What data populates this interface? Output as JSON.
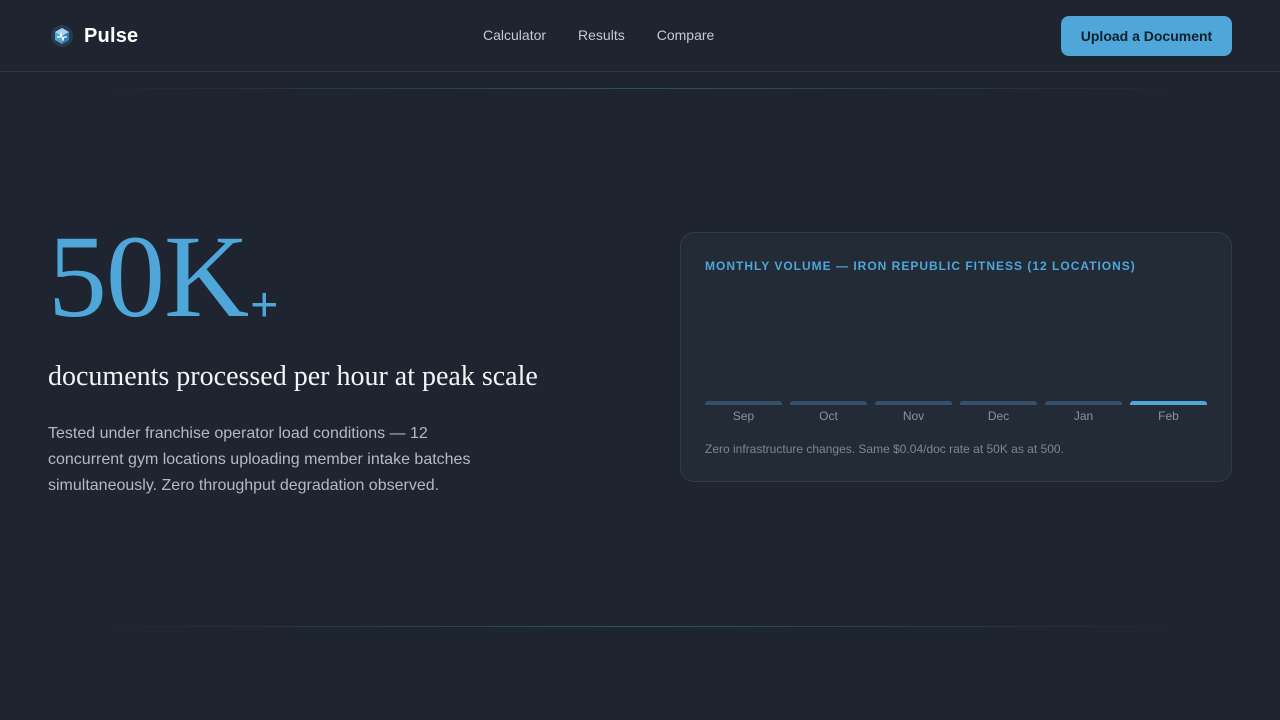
{
  "header": {
    "brand": "Pulse",
    "logo_icon": "pulse-logo-icon",
    "nav": [
      {
        "label": "Calculator"
      },
      {
        "label": "Results"
      },
      {
        "label": "Compare"
      }
    ],
    "cta_label": "Upload a Document"
  },
  "hero": {
    "number": "50K",
    "plus": "+",
    "subtitle": "documents processed per hour at peak scale",
    "description": "Tested under franchise operator load conditions — 12 concurrent gym locations uploading member intake batches simultaneously. Zero throughput degradation observed."
  },
  "card": {
    "title": "MONTHLY VOLUME — IRON REPUBLIC FITNESS (12 LOCATIONS)",
    "note": "Zero infrastructure changes. Same $0.04/doc rate at 50K as at 500."
  },
  "colors": {
    "accent": "#4ea6d9",
    "bar": "#34506a",
    "background": "#1e2430"
  },
  "chart_data": {
    "type": "bar",
    "categories": [
      "Sep",
      "Oct",
      "Nov",
      "Dec",
      "Jan",
      "Feb"
    ],
    "values": [
      0.02,
      0.02,
      0.02,
      0.02,
      0.02,
      0.02
    ],
    "highlighted": "Feb",
    "title": "MONTHLY VOLUME — IRON REPUBLIC FITNESS (12 LOCATIONS)",
    "grid": false
  }
}
